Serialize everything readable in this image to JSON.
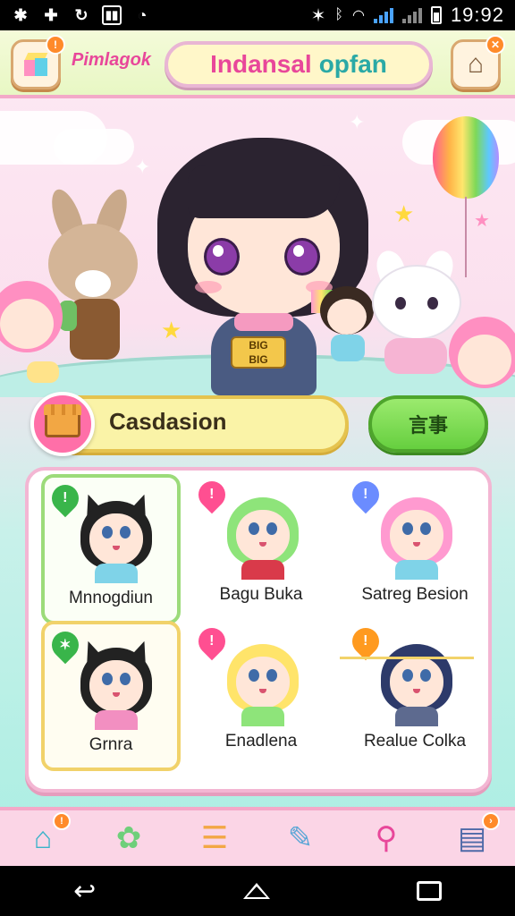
{
  "status_bar": {
    "time": "19:92",
    "left_icons": [
      "snowflake-icon",
      "plus-icon",
      "sync-icon",
      "media-icon",
      "alarm-icon"
    ],
    "right_icons": [
      "star-icon",
      "bluetooth-icon",
      "wifi-icon",
      "signal-icon",
      "battery-icon"
    ]
  },
  "header": {
    "app_name": "Pimlagok",
    "title_main": "Indansal",
    "title_sub": "opfan",
    "left_badge": "!",
    "right_badge": "✕"
  },
  "hero": {
    "name_tag": "BIG\nBIG"
  },
  "search": {
    "text": "Casdasion",
    "button_label": "言事"
  },
  "characters": [
    {
      "name": "Mnnogdiun",
      "pin_color": "#39b54a",
      "pin_symbol": "!",
      "hair": "#222",
      "body": "#7fd3e8",
      "ears": true,
      "selected": "green"
    },
    {
      "name": "Bagu Buka",
      "pin_color": "#ff4f91",
      "pin_symbol": "!",
      "hair": "#8ee47a",
      "body": "#d93a4a",
      "ears": false,
      "selected": ""
    },
    {
      "name": "Satreg Besion",
      "pin_color": "#6b8cff",
      "pin_symbol": "!",
      "hair": "#ff9ad0",
      "body": "#7fd3e8",
      "ears": false,
      "selected": ""
    },
    {
      "name": "Grnra",
      "pin_color": "#39b54a",
      "pin_symbol": "✶",
      "hair": "#222",
      "body": "#f28fc1",
      "ears": true,
      "selected": "gold"
    },
    {
      "name": "Enadlena",
      "pin_color": "#ff4f91",
      "pin_symbol": "!",
      "hair": "#ffe46a",
      "body": "#8ee47a",
      "ears": false,
      "selected": ""
    },
    {
      "name": "Realue Colka",
      "pin_color": "#ff9a1f",
      "pin_symbol": "!",
      "hair": "#2d3a6a",
      "body": "#5d6a8f",
      "ears": false,
      "selected": ""
    }
  ],
  "bottom_nav": [
    {
      "icon": "home-icon",
      "glyph": "⌂",
      "badge": "!"
    },
    {
      "icon": "pet-icon",
      "glyph": "✿",
      "badge": ""
    },
    {
      "icon": "stack-icon",
      "glyph": "☰",
      "badge": ""
    },
    {
      "icon": "book-icon",
      "glyph": "✎",
      "badge": ""
    },
    {
      "icon": "magnifier-icon",
      "glyph": "⚲",
      "badge": ""
    },
    {
      "icon": "notes-icon",
      "glyph": "▤",
      "badge": "›"
    }
  ],
  "colors": {
    "accent_pink": "#e8479a",
    "accent_teal": "#2aa9a6",
    "search_bg": "#faf3a7",
    "go_green": "#66cf3f"
  }
}
